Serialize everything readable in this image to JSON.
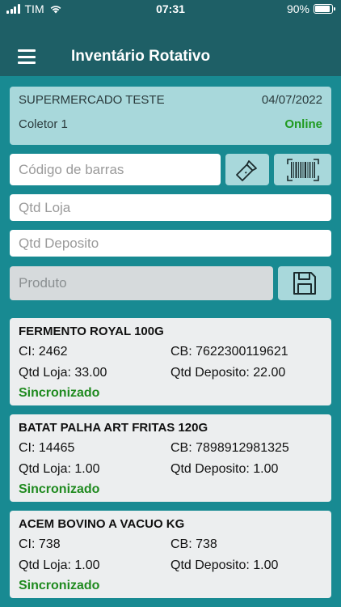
{
  "status_bar": {
    "carrier": "TIM",
    "time": "07:31",
    "battery": "90%",
    "battery_level": 0.9
  },
  "header": {
    "title": "Inventário Rotativo",
    "menu_icon": "hamburger-menu-icon"
  },
  "info": {
    "store": "SUPERMERCADO TESTE",
    "date": "04/07/2022",
    "collector": "Coletor 1",
    "connection": "Online",
    "connection_color": "#1F9A1F"
  },
  "form": {
    "barcode_placeholder": "Código de barras",
    "qtd_loja_placeholder": "Qtd Loja",
    "qtd_deposito_placeholder": "Qtd Deposito",
    "produto_placeholder": "Produto",
    "flashlight_icon": "flashlight-icon",
    "barcode_icon": "barcode-scanner-icon",
    "save_icon": "save-floppy-icon"
  },
  "items": [
    {
      "name": "FERMENTO ROYAL 100G",
      "ci": "CI: 2462",
      "cb": "CB: 7622300119621",
      "qtd_loja": "Qtd Loja: 33.00",
      "qtd_deposito": "Qtd Deposito: 22.00",
      "status": "Sincronizado"
    },
    {
      "name": "BATAT PALHA ART FRITAS 120G",
      "ci": "CI: 14465",
      "cb": "CB: 7898912981325",
      "qtd_loja": "Qtd Loja: 1.00",
      "qtd_deposito": "Qtd Deposito: 1.00",
      "status": "Sincronizado"
    },
    {
      "name": "ACEM BOVINO A VACUO KG",
      "ci": "CI: 738",
      "cb": "CB: 738",
      "qtd_loja": "Qtd Loja: 1.00",
      "qtd_deposito": "Qtd Deposito: 1.00",
      "status": "Sincronizado"
    }
  ],
  "colors": {
    "background": "#188A92",
    "header": "#1E5F66",
    "info_card": "#A8D8DB",
    "synced": "#1F8A1F"
  }
}
